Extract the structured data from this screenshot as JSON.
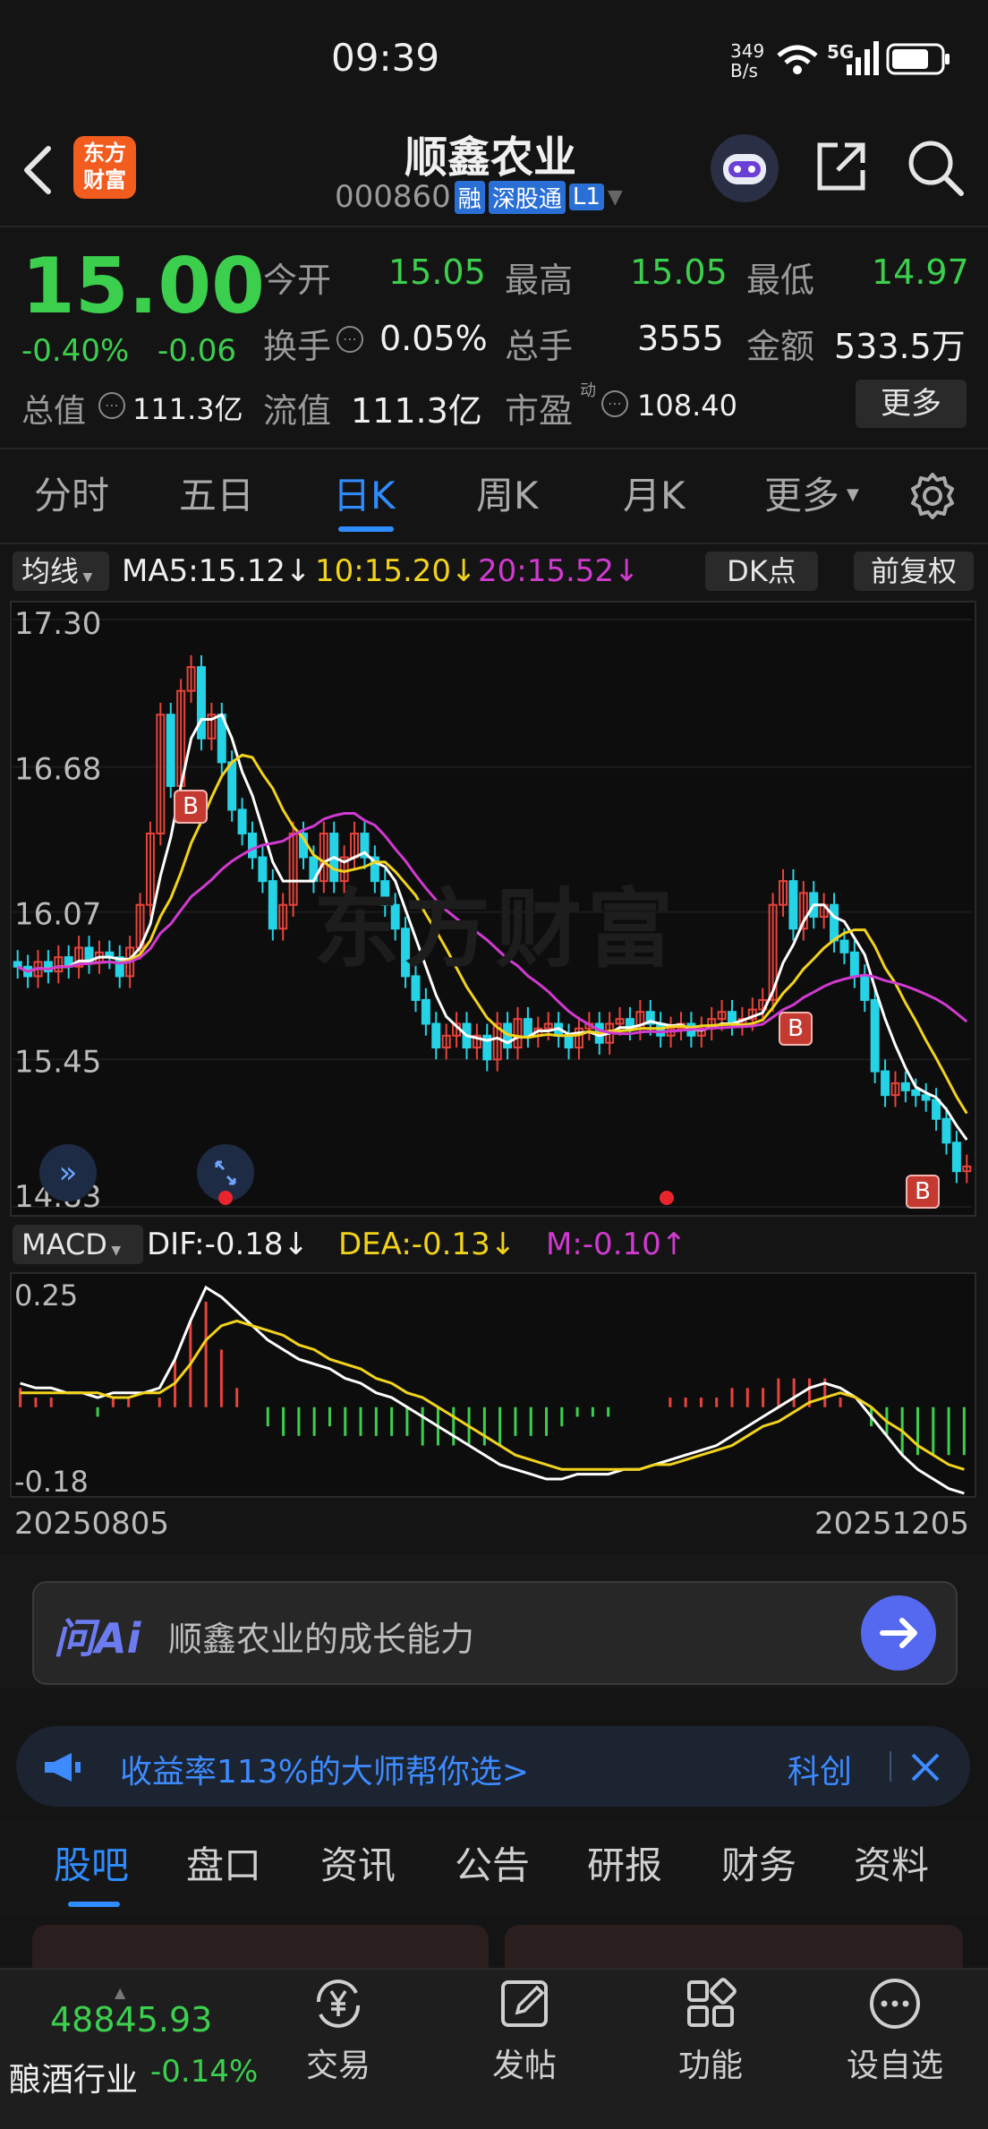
{
  "status": {
    "time": "09:39",
    "speed": "349\nB/s",
    "network": "5G"
  },
  "header": {
    "brand_badge": "东方\n财富",
    "title": "顺鑫农业",
    "code": "000860",
    "tags": [
      "融",
      "深股通",
      "L1"
    ]
  },
  "quote": {
    "price": "15.00",
    "change_pct": "-0.40%",
    "change": "-0.06",
    "open_label": "今开",
    "open": "15.05",
    "high_label": "最高",
    "high": "15.05",
    "low_label": "最低",
    "low": "14.97",
    "turnover_label": "换手",
    "turnover": "0.05%",
    "volume_label": "总手",
    "volume": "3555",
    "amount_label": "金额",
    "amount": "533.5万",
    "mktcap_label": "总值",
    "mktcap": "111.3亿",
    "float_label": "流值",
    "float": "111.3亿",
    "pe_label": "市盈",
    "pe_sup": "动",
    "pe": "108.40",
    "more_button": "更多"
  },
  "period_tabs": [
    "分时",
    "五日",
    "日K",
    "周K",
    "月K",
    "更多"
  ],
  "active_period": 2,
  "indicator_bar": {
    "ma_select": "均线",
    "ma5": "MA5:15.12↓",
    "ma10": "10:15.20↓",
    "ma20": "20:15.52↓",
    "dk_button": "DK点",
    "adjust_button": "前复权"
  },
  "macd_bar": {
    "select": "MACD",
    "dif": "DIF:-0.18↓",
    "dea": "DEA:-0.13↓",
    "m": "M:-0.10↑"
  },
  "chart_data": [
    {
      "type": "candlestick",
      "title": "日K",
      "y_ticks": [
        "17.30",
        "16.68",
        "16.07",
        "15.45",
        "14.83"
      ],
      "ylim": [
        14.83,
        17.3
      ],
      "x_start": "20250805",
      "x_end": "20251205",
      "close": [
        15.84,
        15.8,
        15.86,
        15.82,
        15.88,
        15.84,
        15.92,
        15.86,
        15.9,
        15.88,
        15.8,
        15.92,
        16.1,
        16.4,
        16.9,
        16.6,
        17.0,
        17.1,
        16.8,
        16.9,
        16.7,
        16.5,
        16.4,
        16.3,
        16.2,
        16.0,
        16.1,
        16.4,
        16.3,
        16.2,
        16.4,
        16.2,
        16.3,
        16.4,
        16.3,
        16.2,
        16.1,
        16.0,
        15.8,
        15.7,
        15.6,
        15.5,
        15.55,
        15.6,
        15.5,
        15.55,
        15.45,
        15.6,
        15.5,
        15.62,
        15.55,
        15.58,
        15.6,
        15.55,
        15.5,
        15.58,
        15.6,
        15.52,
        15.6,
        15.62,
        15.58,
        15.65,
        15.6,
        15.55,
        15.58,
        15.6,
        15.55,
        15.58,
        15.62,
        15.65,
        15.6,
        15.62,
        15.66,
        15.7,
        16.1,
        16.2,
        16.0,
        16.15,
        16.05,
        16.1,
        15.95,
        15.9,
        15.8,
        15.7,
        15.4,
        15.3,
        15.35,
        15.32,
        15.3,
        15.28,
        15.2,
        15.1,
        14.98,
        15.0
      ],
      "ma_lines": [
        {
          "name": "MA5",
          "color": "#ffffff"
        },
        {
          "name": "10",
          "color": "#f2d31b"
        },
        {
          "name": "20",
          "color": "#d13ad1"
        }
      ],
      "markers": [
        "B",
        "B",
        "B"
      ]
    },
    {
      "type": "bar",
      "title": "MACD",
      "y_ticks": [
        "0.25",
        "-0.18"
      ],
      "ylim": [
        -0.18,
        0.25
      ],
      "dif": [
        0.05,
        0.04,
        0.04,
        0.03,
        0.03,
        0.02,
        0.03,
        0.03,
        0.03,
        0.04,
        0.1,
        0.18,
        0.25,
        0.23,
        0.2,
        0.17,
        0.14,
        0.12,
        0.1,
        0.09,
        0.08,
        0.06,
        0.05,
        0.03,
        0.02,
        0.0,
        -0.02,
        -0.04,
        -0.06,
        -0.08,
        -0.1,
        -0.12,
        -0.13,
        -0.14,
        -0.15,
        -0.15,
        -0.14,
        -0.14,
        -0.14,
        -0.13,
        -0.13,
        -0.12,
        -0.11,
        -0.1,
        -0.09,
        -0.08,
        -0.06,
        -0.04,
        -0.02,
        0.0,
        0.02,
        0.04,
        0.05,
        0.04,
        0.02,
        -0.02,
        -0.06,
        -0.1,
        -0.13,
        -0.15,
        -0.17,
        -0.18
      ],
      "dea": [
        0.03,
        0.03,
        0.03,
        0.03,
        0.03,
        0.03,
        0.02,
        0.02,
        0.03,
        0.03,
        0.05,
        0.09,
        0.14,
        0.17,
        0.18,
        0.17,
        0.16,
        0.15,
        0.13,
        0.12,
        0.1,
        0.09,
        0.08,
        0.06,
        0.05,
        0.03,
        0.02,
        0.0,
        -0.02,
        -0.04,
        -0.06,
        -0.08,
        -0.1,
        -0.11,
        -0.12,
        -0.13,
        -0.13,
        -0.13,
        -0.13,
        -0.13,
        -0.13,
        -0.12,
        -0.12,
        -0.11,
        -0.1,
        -0.09,
        -0.08,
        -0.06,
        -0.04,
        -0.03,
        -0.01,
        0.01,
        0.02,
        0.03,
        0.02,
        0.0,
        -0.03,
        -0.05,
        -0.08,
        -0.1,
        -0.12,
        -0.13
      ],
      "m": [
        0.04,
        0.02,
        0.02,
        0.0,
        0.0,
        -0.02,
        0.02,
        0.02,
        0.0,
        0.02,
        0.1,
        0.18,
        0.22,
        0.12,
        0.04,
        0.0,
        -0.04,
        -0.06,
        -0.06,
        -0.06,
        -0.04,
        -0.06,
        -0.06,
        -0.06,
        -0.06,
        -0.06,
        -0.08,
        -0.08,
        -0.08,
        -0.08,
        -0.08,
        -0.08,
        -0.06,
        -0.06,
        -0.06,
        -0.04,
        -0.02,
        -0.02,
        -0.02,
        0.0,
        0.0,
        0.0,
        0.02,
        0.02,
        0.02,
        0.02,
        0.04,
        0.04,
        0.04,
        0.06,
        0.06,
        0.06,
        0.06,
        0.02,
        0.0,
        -0.04,
        -0.06,
        -0.1,
        -0.1,
        -0.1,
        -0.1,
        -0.1
      ]
    }
  ],
  "ai_bar": {
    "logo": "问Ai",
    "prompt": "顺鑫农业的成长能力"
  },
  "banner": {
    "text": "收益率113%的大师帮你选>",
    "right_text": "科创"
  },
  "section_tabs": [
    "股吧",
    "盘口",
    "资讯",
    "公告",
    "研报",
    "财务",
    "资料"
  ],
  "active_section": 0,
  "bottom_bar": {
    "index_value": "48845.93",
    "index_name": "酿酒行业",
    "index_change": "-0.14%",
    "nav": [
      "交易",
      "发帖",
      "功能",
      "设自选"
    ]
  }
}
